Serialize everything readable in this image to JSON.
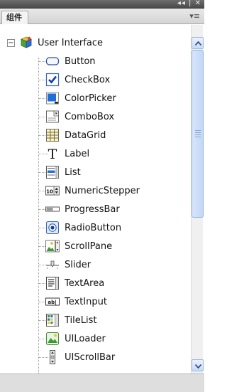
{
  "titlebar": {
    "collapse_glyph": "◂◂",
    "sep": "|",
    "close_glyph": "✕"
  },
  "panel": {
    "tab_label": "组件",
    "menu_glyph": "▾≡"
  },
  "tree": {
    "root": {
      "expander": "−",
      "label": "User Interface",
      "icon": "component-package-icon"
    },
    "items": [
      {
        "label": "Button",
        "icon": "button-icon"
      },
      {
        "label": "CheckBox",
        "icon": "checkbox-icon"
      },
      {
        "label": "ColorPicker",
        "icon": "colorpicker-icon"
      },
      {
        "label": "ComboBox",
        "icon": "combobox-icon"
      },
      {
        "label": "DataGrid",
        "icon": "datagrid-icon"
      },
      {
        "label": "Label",
        "icon": "label-icon"
      },
      {
        "label": "List",
        "icon": "list-icon"
      },
      {
        "label": "NumericStepper",
        "icon": "numericstepper-icon"
      },
      {
        "label": "ProgressBar",
        "icon": "progressbar-icon"
      },
      {
        "label": "RadioButton",
        "icon": "radiobutton-icon"
      },
      {
        "label": "ScrollPane",
        "icon": "scrollpane-icon"
      },
      {
        "label": "Slider",
        "icon": "slider-icon"
      },
      {
        "label": "TextArea",
        "icon": "textarea-icon"
      },
      {
        "label": "TextInput",
        "icon": "textinput-icon"
      },
      {
        "label": "TileList",
        "icon": "tilelist-icon"
      },
      {
        "label": "UILoader",
        "icon": "uiloader-icon"
      },
      {
        "label": "UIScrollBar",
        "icon": "uiscrollbar-icon"
      }
    ]
  },
  "scrollbar": {
    "up_glyph": "▲",
    "down_glyph": "▼"
  },
  "colors": {
    "accent": "#c7dbf6",
    "check": "#0a3fa8"
  }
}
